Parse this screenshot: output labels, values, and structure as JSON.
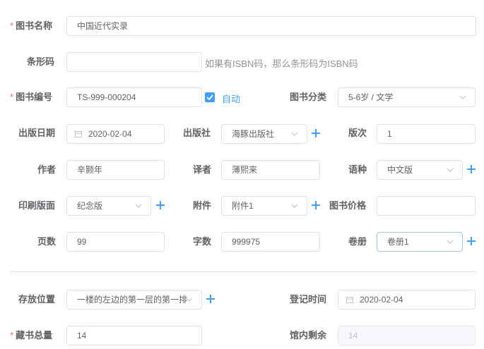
{
  "labels": {
    "book_name": "图书名称",
    "barcode": "条形码",
    "book_no": "图书编号",
    "category": "图书分类",
    "pub_date": "出版日期",
    "publisher": "出版社",
    "edition": "版次",
    "author": "作者",
    "translator": "译者",
    "language": "语种",
    "print_layout": "印刷版面",
    "attachment": "附件",
    "price": "图书价格",
    "pages": "页数",
    "words": "字数",
    "volume": "卷册",
    "location": "存放位置",
    "register_time": "登记时间",
    "total": "藏书总量",
    "remaining": "馆内剩余"
  },
  "required_mark": "*",
  "values": {
    "book_name": "中国近代实录",
    "barcode": "",
    "book_no": "TS-999-000204",
    "category": "5-6岁 / 文学",
    "pub_date": "2020-02-04",
    "publisher": "海豚出版社",
    "edition": "1",
    "author": "辛颢年",
    "translator": "薄熙来",
    "language": "中文版",
    "print_layout": "纪念版",
    "attachment": "附件1",
    "price": "",
    "pages": "99",
    "words": "999975",
    "volume": "卷册1",
    "location": "一楼的左边的第一层的第一排",
    "register_time": "2020-02-04",
    "total": "14",
    "remaining": "14"
  },
  "barcode_hint": "如果有ISBN码，那么条形码为ISBN码",
  "auto_checkbox": {
    "label": "自动",
    "checked": true
  },
  "colors": {
    "primary": "#409eff",
    "required": "#f56c6c",
    "border": "#dcdfe6"
  }
}
